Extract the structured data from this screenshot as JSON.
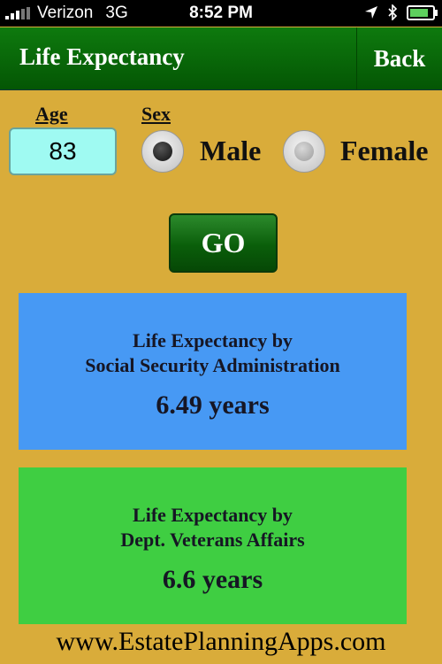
{
  "status_bar": {
    "carrier": "Verizon",
    "network": "3G",
    "time": "8:52 PM",
    "battery_level": 0.85,
    "icons": [
      "signal-icon",
      "location-arrow-icon",
      "bluetooth-icon",
      "battery-charging-icon"
    ]
  },
  "navbar": {
    "title": "Life Expectancy",
    "back_label": "Back"
  },
  "form": {
    "age_label": "Age",
    "age_value": "83",
    "sex_label": "Sex",
    "male_label": "Male",
    "female_label": "Female",
    "selected_sex": "Male",
    "go_label": "GO"
  },
  "results": {
    "ssa": {
      "line1": "Life Expectancy by",
      "line2": "Social Security Administration",
      "value": "6.49 years",
      "color": "#4799f4"
    },
    "va": {
      "line1": "Life Expectancy by",
      "line2": "Dept. Veterans Affairs",
      "value": "6.6 years",
      "color": "#3fce42"
    }
  },
  "footer": {
    "website": "www.EstatePlanningApps.com"
  },
  "colors": {
    "background": "#d9ac3a",
    "navbar": "#0a6a0a",
    "age_field": "#9ffaf2"
  }
}
